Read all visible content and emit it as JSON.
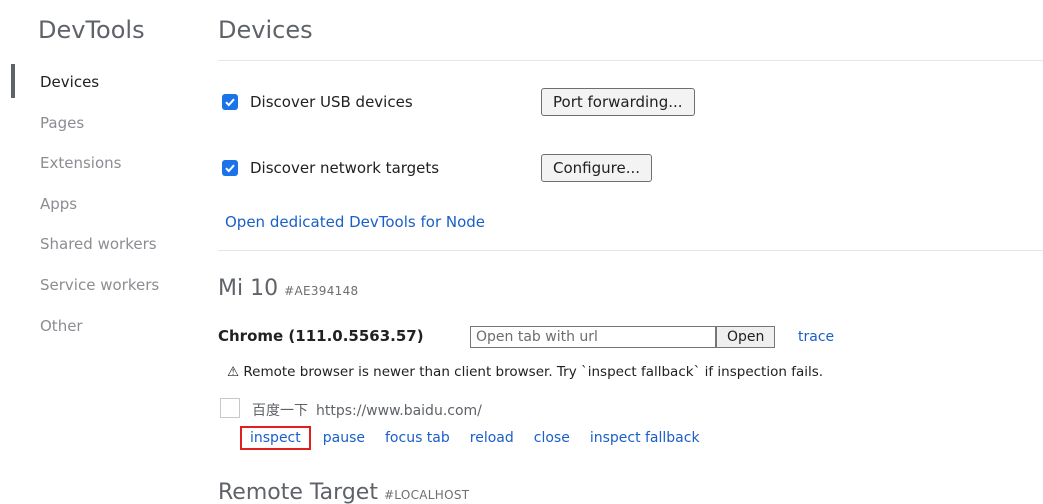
{
  "sidebar": {
    "title": "DevTools",
    "items": [
      {
        "label": "Devices",
        "selected": true
      },
      {
        "label": "Pages",
        "selected": false
      },
      {
        "label": "Extensions",
        "selected": false
      },
      {
        "label": "Apps",
        "selected": false
      },
      {
        "label": "Shared workers",
        "selected": false
      },
      {
        "label": "Service workers",
        "selected": false
      },
      {
        "label": "Other",
        "selected": false
      }
    ]
  },
  "main": {
    "title": "Devices",
    "discover_usb": {
      "label": "Discover USB devices",
      "checked": true,
      "button": "Port forwarding..."
    },
    "discover_network": {
      "label": "Discover network targets",
      "checked": true,
      "button": "Configure..."
    },
    "node_link": "Open dedicated DevTools for Node",
    "device": {
      "name": "Mi 10",
      "serial": "#AE394148",
      "browser": "Chrome (111.0.5563.57)",
      "url_placeholder": "Open tab with url",
      "open_button": "Open",
      "trace_link": "trace",
      "warning_icon": "warning-triangle-icon",
      "warning": "⚠ Remote browser is newer than client browser. Try `inspect fallback` if inspection fails.",
      "target": {
        "title": "百度一下",
        "url": "https://www.baidu.com/",
        "actions": [
          "inspect",
          "pause",
          "focus tab",
          "reload",
          "close",
          "inspect fallback"
        ]
      }
    },
    "remote": {
      "title": "Remote Target",
      "subtitle": "#LOCALHOST"
    }
  },
  "colors": {
    "accent": "#1a73e8",
    "link": "#1a5fc9",
    "highlight_box": "#e0201e"
  }
}
